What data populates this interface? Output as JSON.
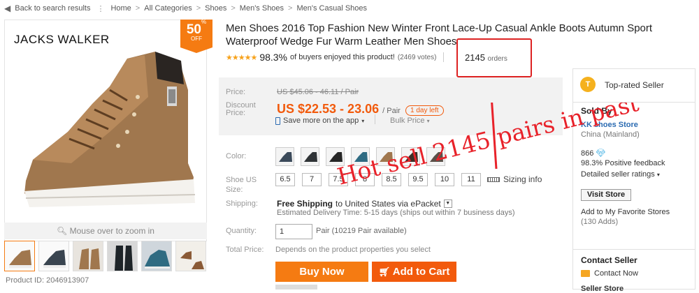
{
  "breadcrumb": {
    "back": "Back to search results",
    "items": [
      "Home",
      "All Categories",
      "Shoes",
      "Men's Shoes",
      "Men's Casual Shoes"
    ],
    "separator": ">"
  },
  "gallery": {
    "brand": "JACKS WALKER",
    "promo_percent": "50",
    "promo_unit": "% OFF",
    "zoom_hint": "Mouse over to zoom in",
    "product_id": "Product ID: 2046913907"
  },
  "product": {
    "title": "Men Shoes 2016 Top Fashion New Winter Front Lace-Up Casual Ankle Boots Autumn Sport Waterproof Wedge Fur Warm Leather Men Shoes",
    "stars": "★★★★★",
    "buyer_pct": "98.3%",
    "buyer_text": "of buyers enjoyed this product!",
    "votes": "(2469 votes)",
    "orders_count": "2145",
    "orders_label": "orders"
  },
  "price": {
    "price_label": "Price:",
    "old_price": "US $45.06 - 46.11 / Pair",
    "discount_label": "Discount Price:",
    "current_price": "US $22.53 - 23.06",
    "per_unit": "/ Pair",
    "days_left": "1 day left",
    "mobile_deal": "Save more on the app",
    "bulk_price": "Bulk Price"
  },
  "options": {
    "color_label": "Color:",
    "size_label": "Shoe US Size:",
    "sizes": [
      "6.5",
      "7",
      "7.5",
      "8",
      "8.5",
      "9.5",
      "10",
      "11"
    ],
    "sizing_info": "Sizing info",
    "shipping_label": "Shipping:",
    "free_shipping": "Free Shipping",
    "ship_to": "to United States via ePacket",
    "delivery": "Estimated Delivery Time: 5-15 days (ships out within 7 business days)",
    "quantity_label": "Quantity:",
    "quantity_value": "1",
    "quantity_info": "Pair (10219 Pair available)",
    "total_label": "Total Price:",
    "total_value": "Depends on the product properties you select"
  },
  "actions": {
    "buy_now": "Buy Now",
    "add_to_cart": "Add to Cart"
  },
  "seller": {
    "badge": "T",
    "top_rated": "Top-rated Seller",
    "sold_by": "Sold By",
    "store_name": "KK shoes Store",
    "store_location": "China (Mainland)",
    "score": "866",
    "positive_pct": "98.3%",
    "positive_text": "Positive feedback",
    "detailed_ratings": "Detailed seller ratings",
    "visit_store": "Visit Store",
    "add_favorite": "Add to My Favorite Stores",
    "adds": "(130 Adds)",
    "contact_seller": "Contact Seller",
    "contact_now": "Contact Now",
    "cut_text": "Seller Store"
  },
  "annotation": {
    "text": "Hot sell 2145 pairs in past",
    "color": "#e8222a"
  },
  "colors": {
    "accent": "#f57b12",
    "price": "#f25a0c",
    "link": "#2a6ab1",
    "star": "#f7a21b"
  }
}
